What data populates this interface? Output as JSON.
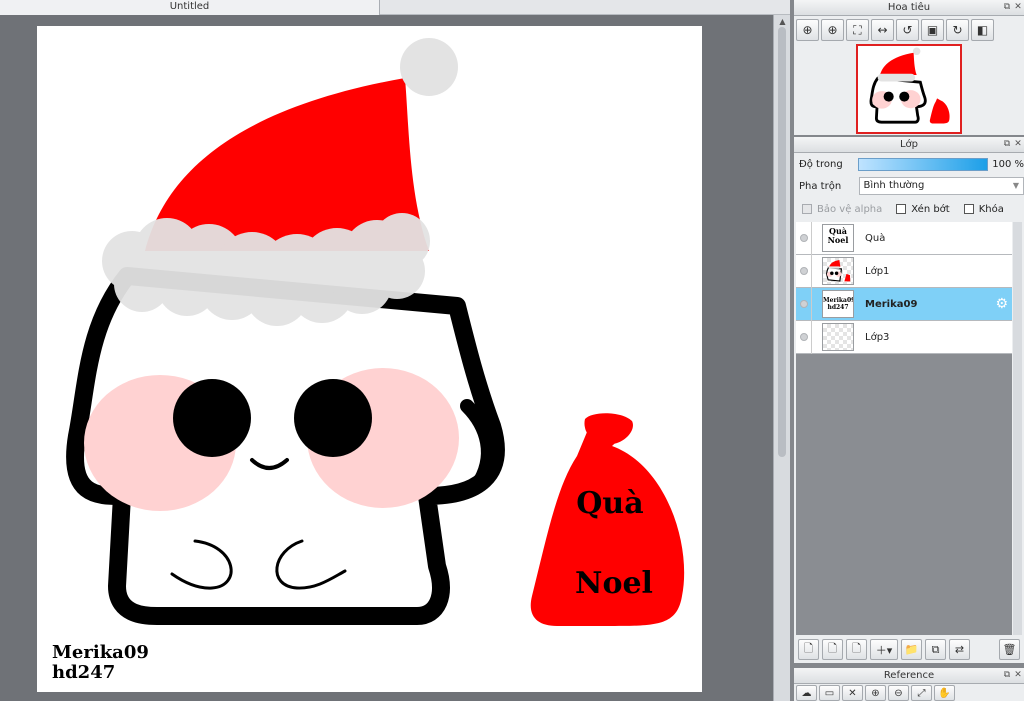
{
  "document": {
    "tab_title": "Untitled"
  },
  "canvas": {
    "signature_line1": "Merika09",
    "signature_line2": "hd247",
    "bag_text_line1": "Quà",
    "bag_text_line2": "Noel",
    "colors": {
      "hat": "#ff0000",
      "fur": "#e3e3e3",
      "blush": "#ffd2d2",
      "outline": "#000000",
      "bag": "#ff0000"
    }
  },
  "navigator": {
    "title": "Hoa tiêu",
    "tools": [
      "zoom-fit-icon",
      "zoom-in-icon",
      "fit-window-icon",
      "fit-width-icon",
      "rotate-left-icon",
      "actual-size-icon",
      "rotate-right-icon",
      "flip-icon"
    ],
    "tool_glyphs": [
      "⊕",
      "⊕",
      "⛶",
      "↔",
      "↺",
      "▣",
      "↻",
      "◧"
    ]
  },
  "layers": {
    "title": "Lớp",
    "opacity_label": "Độ trong",
    "opacity_value": "100 %",
    "opacity": 1.0,
    "blend_label": "Pha trộn",
    "blend_value": "Bình thường",
    "protect_alpha": "Bảo vệ alpha",
    "clipping": "Xén bớt",
    "lock": "Khóa",
    "items": [
      {
        "name": "Quà",
        "thumb_text": "Quà Noel"
      },
      {
        "name": "Lớp1"
      },
      {
        "name": "Merika09",
        "thumb_text": "Merika09 hd247",
        "active": true
      },
      {
        "name": "Lớp3"
      }
    ],
    "footer_glyphs": [
      "🗋",
      "🗋",
      "🗋",
      "＋▾",
      "📁",
      "⧉",
      "⇄",
      "🗑"
    ]
  },
  "reference": {
    "title": "Reference",
    "tool_glyphs": [
      "☁",
      "▭",
      "✕",
      "⊕",
      "⊖",
      "⤢",
      "✋"
    ]
  }
}
